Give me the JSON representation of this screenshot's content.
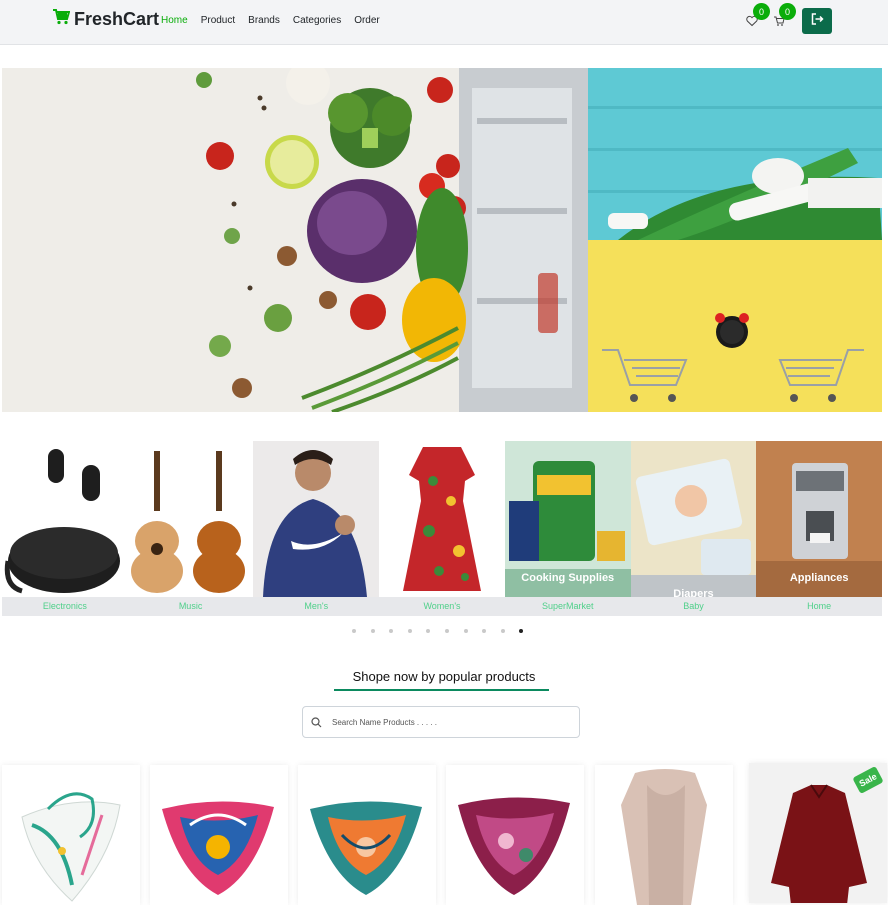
{
  "brand": {
    "name": "FreshCart",
    "accent": "#0aad0a"
  },
  "nav": {
    "links": [
      "Home",
      "Product",
      "Brands",
      "Categories",
      "Order"
    ],
    "active": "Home",
    "wishlist_count": "0",
    "cart_count": "0"
  },
  "categories": [
    {
      "label": "Electronics"
    },
    {
      "label": "Music"
    },
    {
      "label": "Men's"
    },
    {
      "label": "Women's"
    },
    {
      "label": "SuperMarket",
      "overlay": "Cooking Supplies"
    },
    {
      "label": "Baby",
      "overlay": "Diapers"
    },
    {
      "label": "Home",
      "overlay": "Appliances"
    }
  ],
  "carousel": {
    "dot_count": 10,
    "active_index": 9
  },
  "section": {
    "title": "Shope now by popular products"
  },
  "search": {
    "placeholder": "Search Name Products . . . . ."
  },
  "products": [
    {
      "image": "white scarf with teal print"
    },
    {
      "image": "pink and blue scarf"
    },
    {
      "image": "orange and teal scarf"
    },
    {
      "image": "magenta patterned scarf"
    },
    {
      "image": "beige long scarf"
    },
    {
      "image": "maroon blouse",
      "badge": "Sale"
    }
  ]
}
